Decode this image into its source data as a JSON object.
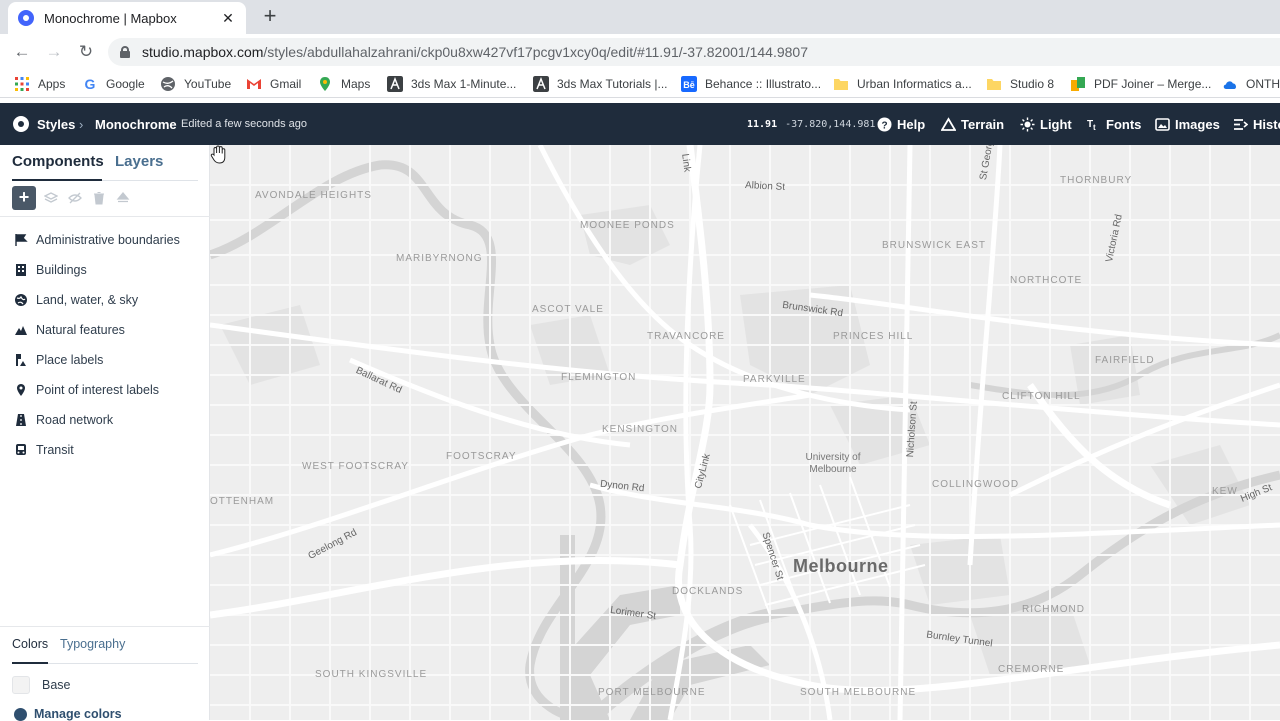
{
  "browser": {
    "tab_title": "Monochrome | Mapbox",
    "tab_close": "✕",
    "new_tab": "+",
    "back": "←",
    "forward": "→",
    "reload": "↻",
    "url_host": "studio.mapbox.com",
    "url_path": "/styles/abdullahalzahrani/ckp0u8xw427vf17pcgv1xcy0q/edit/#11.91/-37.82001/144.9807",
    "bookmarks": [
      {
        "label": "Apps",
        "icon": "apps-grid-icon",
        "color": "#ea4335"
      },
      {
        "label": "Google",
        "icon": "google-icon",
        "color": "#4285f4"
      },
      {
        "label": "YouTube",
        "icon": "globe-icon",
        "color": "#5f6368"
      },
      {
        "label": "Gmail",
        "icon": "gmail-icon",
        "color": "#ea4335"
      },
      {
        "label": "Maps",
        "icon": "maps-pin-icon",
        "color": "#34a853"
      },
      {
        "label": "3ds Max 1-Minute...",
        "icon": "autodesk-icon",
        "color": "#5f6368"
      },
      {
        "label": "3ds Max Tutorials |...",
        "icon": "autodesk-icon",
        "color": "#5f6368"
      },
      {
        "label": "Behance :: Illustrato...",
        "icon": "behance-icon",
        "color": "#1769ff"
      },
      {
        "label": "Urban Informatics a...",
        "icon": "folder-icon",
        "color": "#fdd663"
      },
      {
        "label": "Studio 8",
        "icon": "folder-icon",
        "color": "#fdd663"
      },
      {
        "label": "PDF Joiner – Merge...",
        "icon": "pdf-joiner-icon",
        "color": "#f9ab00"
      },
      {
        "label": "ONTH",
        "icon": "cloud-icon",
        "color": "#1a73e8"
      }
    ]
  },
  "studio": {
    "styles_label": "Styles",
    "style_name": "Monochrome",
    "edited_status": "Edited a few seconds ago",
    "zoom": "11.91",
    "latlng": "-37.820,144.981",
    "actions": [
      "Help",
      "Terrain",
      "Light",
      "Fonts",
      "Images",
      "Histo"
    ]
  },
  "panel": {
    "tab_components": "Components",
    "tab_layers": "Layers",
    "add_button": "+",
    "components": [
      {
        "label": "Administrative boundaries",
        "icon": "flag-icon"
      },
      {
        "label": "Buildings",
        "icon": "building-icon"
      },
      {
        "label": "Land, water, & sky",
        "icon": "globe-icon"
      },
      {
        "label": "Natural features",
        "icon": "mountain-icon"
      },
      {
        "label": "Place labels",
        "icon": "place-label-icon"
      },
      {
        "label": "Point of interest labels",
        "icon": "marker-icon"
      },
      {
        "label": "Road network",
        "icon": "road-icon"
      },
      {
        "label": "Transit",
        "icon": "bus-icon"
      }
    ],
    "bottom_tab_colors": "Colors",
    "bottom_tab_typography": "Typography",
    "base_label": "Base",
    "manage_colors": "Manage colors"
  },
  "map": {
    "city": "Melbourne",
    "suburbs": [
      "AVONDALE HEIGHTS",
      "MOONEE PONDS",
      "BRUNSWICK EAST",
      "THORNBURY",
      "MARIBYRNONG",
      "NORTHCOTE",
      "ASCOT VALE",
      "TRAVANCORE",
      "PRINCES HILL",
      "FAIRFIELD",
      "FLEMINGTON",
      "PARKVILLE",
      "CLIFTON HILL",
      "KENSINGTON",
      "FOOTSCRAY",
      "WEST FOOTSCRAY",
      "COLLINGWOOD",
      "KEW",
      "OTTENHAM",
      "DOCKLANDS",
      "RICHMOND",
      "CREMORNE",
      "SOUTH KINGSVILLE",
      "PORT MELBOURNE",
      "SOUTH MELBOURNE"
    ],
    "streets": [
      "Albion St",
      "Brunswick Rd",
      "St Georges Rd",
      "Victoria Rd",
      "Ballarat Rd",
      "Nicholson St",
      "CityLink",
      "Dynon Rd",
      "Geelong Rd",
      "Spencer St",
      "Lorimer St",
      "Burnley Tunnel",
      "High St",
      "Link"
    ],
    "poi": "University of Melbourne"
  }
}
